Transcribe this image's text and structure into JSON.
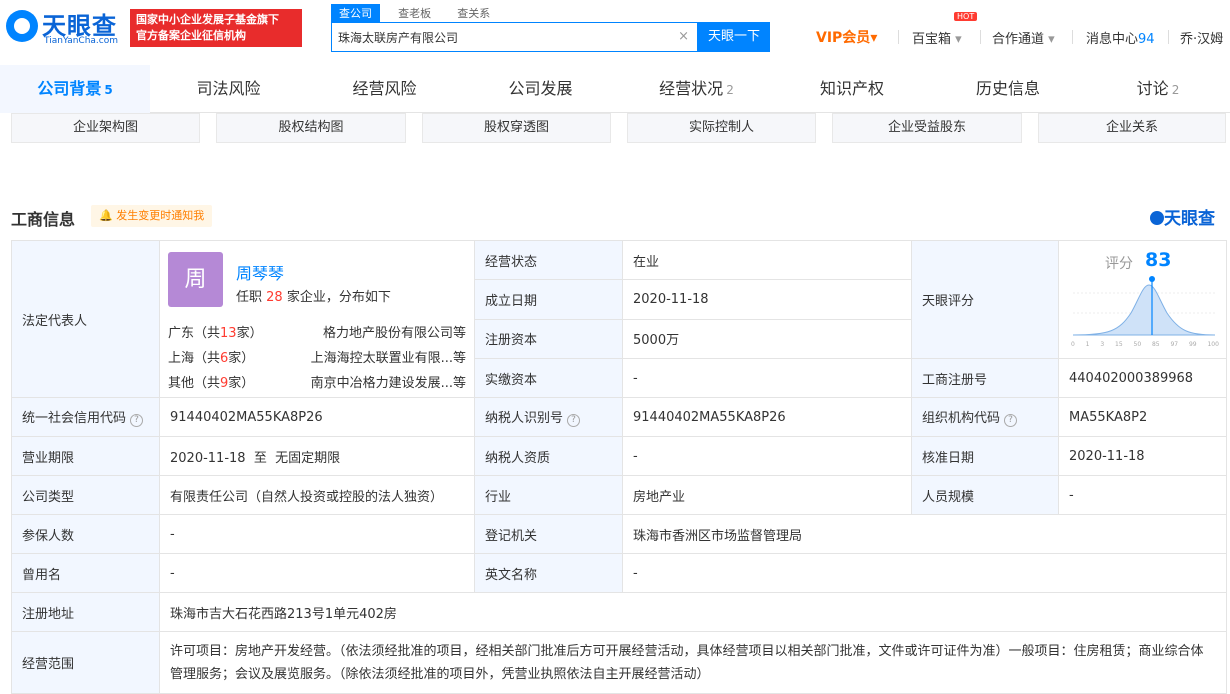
{
  "logo": {
    "cn": "天眼查",
    "en": "TianYanCha.com"
  },
  "badge": {
    "line1": "国家中小企业发展子基金旗下",
    "line2": "官方备案企业征信机构"
  },
  "search": {
    "tabs": [
      "查公司",
      "查老板",
      "查关系"
    ],
    "value": "珠海太联房产有限公司",
    "clear": "×",
    "button": "天眼一下"
  },
  "nav": {
    "vip": "VIP会员",
    "vip_arrow": "▾",
    "box": "百宝箱",
    "box_arrow": "▾",
    "hot": "HOT",
    "channel": "合作通道",
    "channel_arrow": "▾",
    "msg": "消息中心",
    "msg_count": "94",
    "user": "乔·汉姆"
  },
  "tabs": [
    {
      "label": "公司背景",
      "count": "5"
    },
    {
      "label": "司法风险",
      "count": ""
    },
    {
      "label": "经营风险",
      "count": ""
    },
    {
      "label": "公司发展",
      "count": ""
    },
    {
      "label": "经营状况",
      "count": "2"
    },
    {
      "label": "知识产权",
      "count": ""
    },
    {
      "label": "历史信息",
      "count": ""
    },
    {
      "label": "讨论",
      "count": "2"
    }
  ],
  "subbuttons": [
    "企业架构图",
    "股权结构图",
    "股权穿透图",
    "实际控制人",
    "企业受益股东",
    "企业关系"
  ],
  "section": {
    "title": "工商信息",
    "notify_icon": "🔔",
    "notify": "发生变更时通知我",
    "brand": "天眼查"
  },
  "legal": {
    "label": "法定代表人",
    "avatar": "周",
    "name": "周琴琴",
    "role_a": "任职",
    "role_n": "28",
    "role_b": "家企业，分布如下",
    "regions": [
      {
        "l1": "广东（共",
        "n": "13",
        "l2": "家）",
        "company": "格力地产股份有限公司等"
      },
      {
        "l1": "上海（共",
        "n": "6",
        "l2": "家）",
        "company": "上海海控太联置业有限...等"
      },
      {
        "l1": "其他（共",
        "n": "9",
        "l2": "家）",
        "company": "南京中冶格力建设发展...等"
      }
    ]
  },
  "info": {
    "status_l": "经营状态",
    "status_v": "在业",
    "found_l": "成立日期",
    "found_v": "2020-11-18",
    "capital_l": "注册资本",
    "capital_v": "5000万",
    "paid_l": "实缴资本",
    "paid_v": "-",
    "score_l": "天眼评分",
    "score_label": "评分",
    "score": "83",
    "score_ticks": [
      "0",
      "1",
      "3",
      "15",
      "50",
      "85",
      "97",
      "99",
      "100"
    ],
    "regno_l": "工商注册号",
    "regno_v": "440402000389968",
    "credit_l": "统一社会信用代码",
    "credit_v": "91440402MA55KA8P26",
    "tax_l": "纳税人识别号",
    "tax_v": "91440402MA55KA8P26",
    "org_l": "组织机构代码",
    "org_v": "MA55KA8P2",
    "term_l": "营业期限",
    "term_v": "2020-11-18  至  无固定期限",
    "taxq_l": "纳税人资质",
    "taxq_v": "-",
    "approve_l": "核准日期",
    "approve_v": "2020-11-18",
    "type_l": "公司类型",
    "type_v": "有限责任公司（自然人投资或控股的法人独资）",
    "industry_l": "行业",
    "industry_v": "房地产业",
    "staff_l": "人员规模",
    "staff_v": "-",
    "insured_l": "参保人数",
    "insured_v": "-",
    "authority_l": "登记机关",
    "authority_v": "珠海市香洲区市场监督管理局",
    "former_l": "曾用名",
    "former_v": "-",
    "en_l": "英文名称",
    "en_v": "-",
    "addr_l": "注册地址",
    "addr_v": "珠海市吉大石花西路213号1单元402房",
    "scope_l": "经营范围",
    "scope_v": "许可项目：房地产开发经营。（依法须经批准的项目，经相关部门批准后方可开展经营活动，具体经营项目以相关部门批准，文件或许可证件为准）一般项目：住房租赁；商业综合体管理服务；会议及展览服务。（除依法须经批准的项目外，凭营业执照依法自主开展经营活动）"
  }
}
